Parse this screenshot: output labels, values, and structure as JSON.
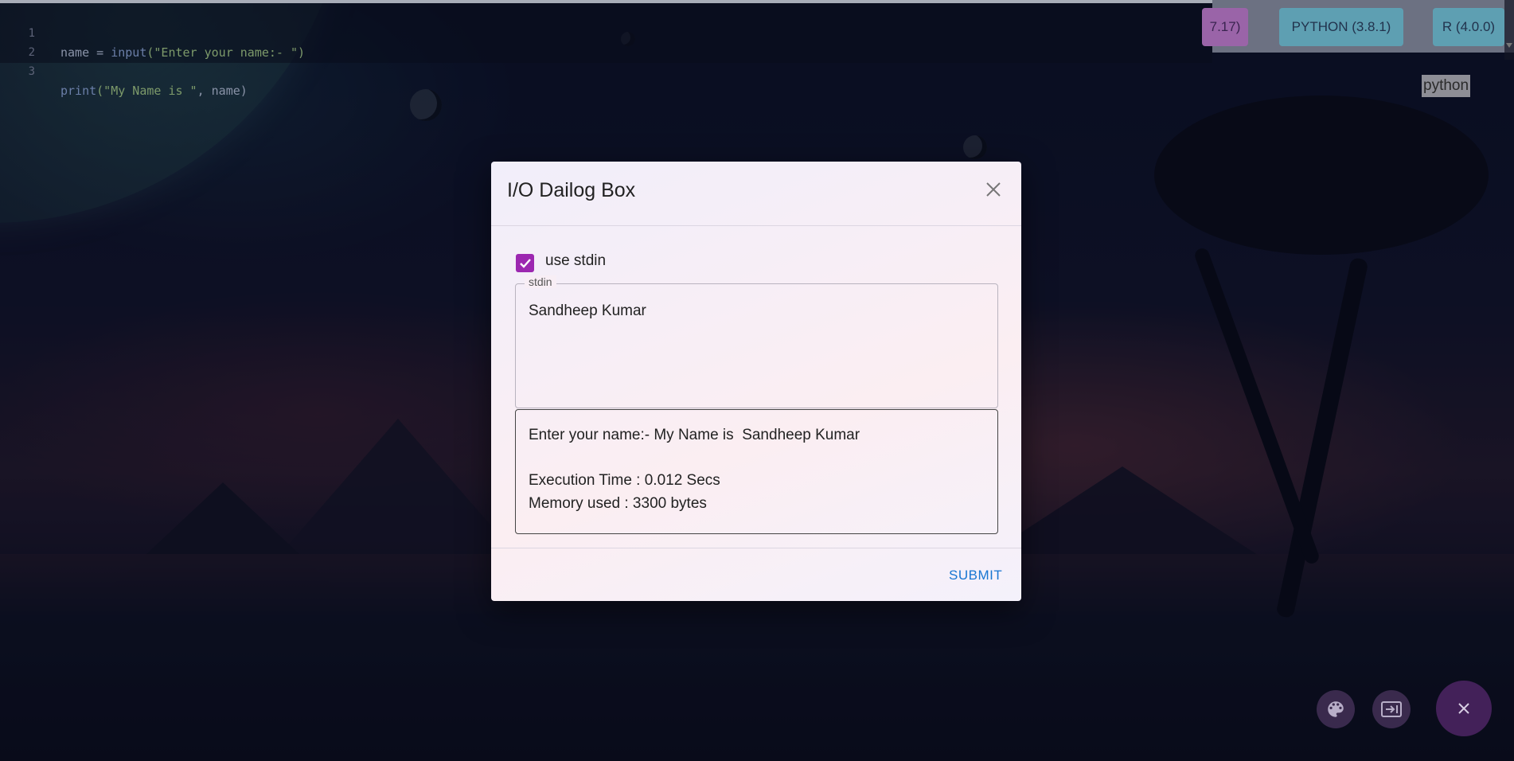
{
  "editor": {
    "lines": [
      {
        "num": "1",
        "parts": [
          "name = ",
          "input",
          "(\"Enter your name:- \")"
        ]
      },
      {
        "num": "2",
        "parts": [
          "",
          "",
          ""
        ]
      },
      {
        "num": "3",
        "parts": [
          "print",
          "(\"My Name is \"",
          ", name)"
        ]
      }
    ]
  },
  "languages": {
    "chips": [
      "7.17)",
      "PYTHON (3.8.1)",
      "R (4.0.0)"
    ],
    "selected_label": "python"
  },
  "dialog": {
    "title": "I/O Dailog Box",
    "close_icon": "close-icon",
    "use_stdin": {
      "label": "use stdin",
      "checked": true
    },
    "stdin": {
      "legend": "stdin",
      "value": "Sandheep Kumar"
    },
    "output": {
      "line1": "Enter your name:- My Name is  Sandheep Kumar",
      "line2": "Execution Time : 0.012 Secs",
      "line3": "Memory used : 3300 bytes"
    },
    "submit_label": "SUBMIT"
  },
  "fabs": {
    "palette_icon": "palette-icon",
    "terminal_icon": "terminal-icon",
    "close_icon": "close-icon"
  },
  "colors": {
    "accent": "#9c27b0",
    "submit": "#1976d2",
    "chip": "#5e9fb2"
  }
}
